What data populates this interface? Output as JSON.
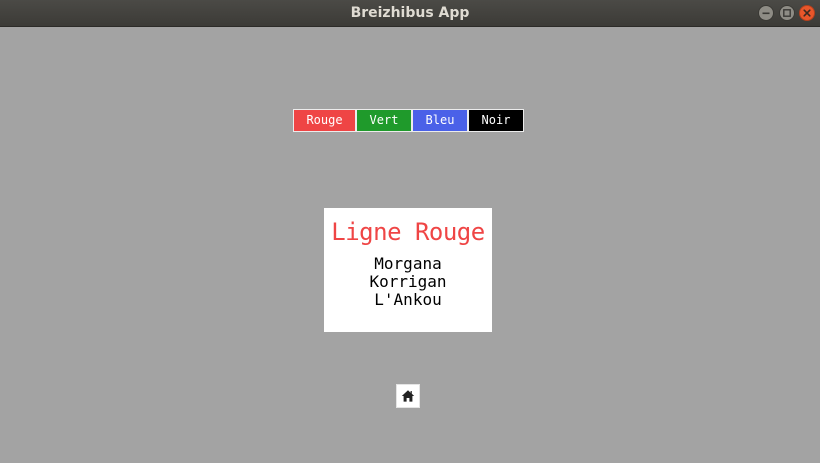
{
  "window": {
    "title": "Breizhibus App"
  },
  "color_buttons": [
    {
      "label": "Rouge",
      "color": "#ef4545"
    },
    {
      "label": "Vert",
      "color": "#1f9a2b"
    },
    {
      "label": "Bleu",
      "color": "#4a61e8"
    },
    {
      "label": "Noir",
      "color": "#000000"
    }
  ],
  "line": {
    "title": "Ligne Rouge",
    "title_color": "#ef4545",
    "stops": [
      "Morgana",
      "Korrigan",
      "L'Ankou"
    ]
  },
  "home": {
    "icon": "home-icon"
  }
}
